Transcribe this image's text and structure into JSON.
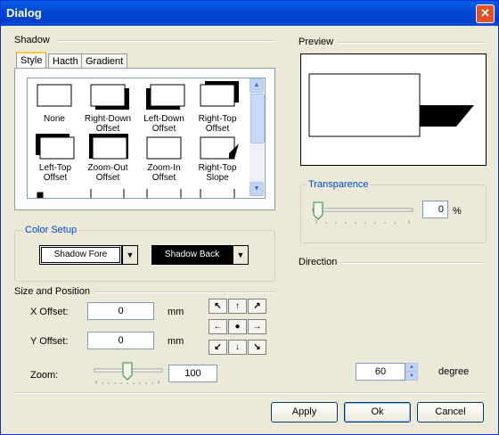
{
  "window": {
    "title": "Dialog",
    "close_icon": "close-icon"
  },
  "shadow": {
    "heading": "Shadow",
    "tabs": [
      "Style",
      "Hacth",
      "Gradient"
    ],
    "selected_tab": "Style",
    "styles": [
      {
        "label": "None"
      },
      {
        "label": "Right-Down Offset"
      },
      {
        "label": "Left-Down Offset"
      },
      {
        "label": "Right-Top Offset"
      },
      {
        "label": "Left-Top Offset"
      },
      {
        "label": "Zoom-Out Offset"
      },
      {
        "label": "Zoom-In Offset"
      },
      {
        "label": "Right-Top Slope"
      }
    ]
  },
  "color_setup": {
    "heading": "Color Setup",
    "fore_label": "Shadow Fore",
    "back_label": "Shadow Back",
    "fore_color": "#ffffff",
    "back_color": "#000000"
  },
  "size_position": {
    "heading": "Size and Position",
    "x_label": "X Offset:",
    "x_value": "0",
    "x_unit": "mm",
    "y_label": "Y Offset:",
    "y_value": "0",
    "y_unit": "mm",
    "zoom_label": "Zoom:",
    "zoom_value": "100",
    "arrows": [
      "↖",
      "↑",
      "↗",
      "←",
      "●",
      "→",
      "↙",
      "↓",
      "↘"
    ]
  },
  "preview": {
    "heading": "Preview"
  },
  "transparence": {
    "heading": "Transparence",
    "value": "0",
    "unit": "%"
  },
  "direction": {
    "heading": "Direction",
    "value": "60",
    "unit": "degree"
  },
  "buttons": {
    "apply": "Apply",
    "ok": "Ok",
    "cancel": "Cancel"
  }
}
